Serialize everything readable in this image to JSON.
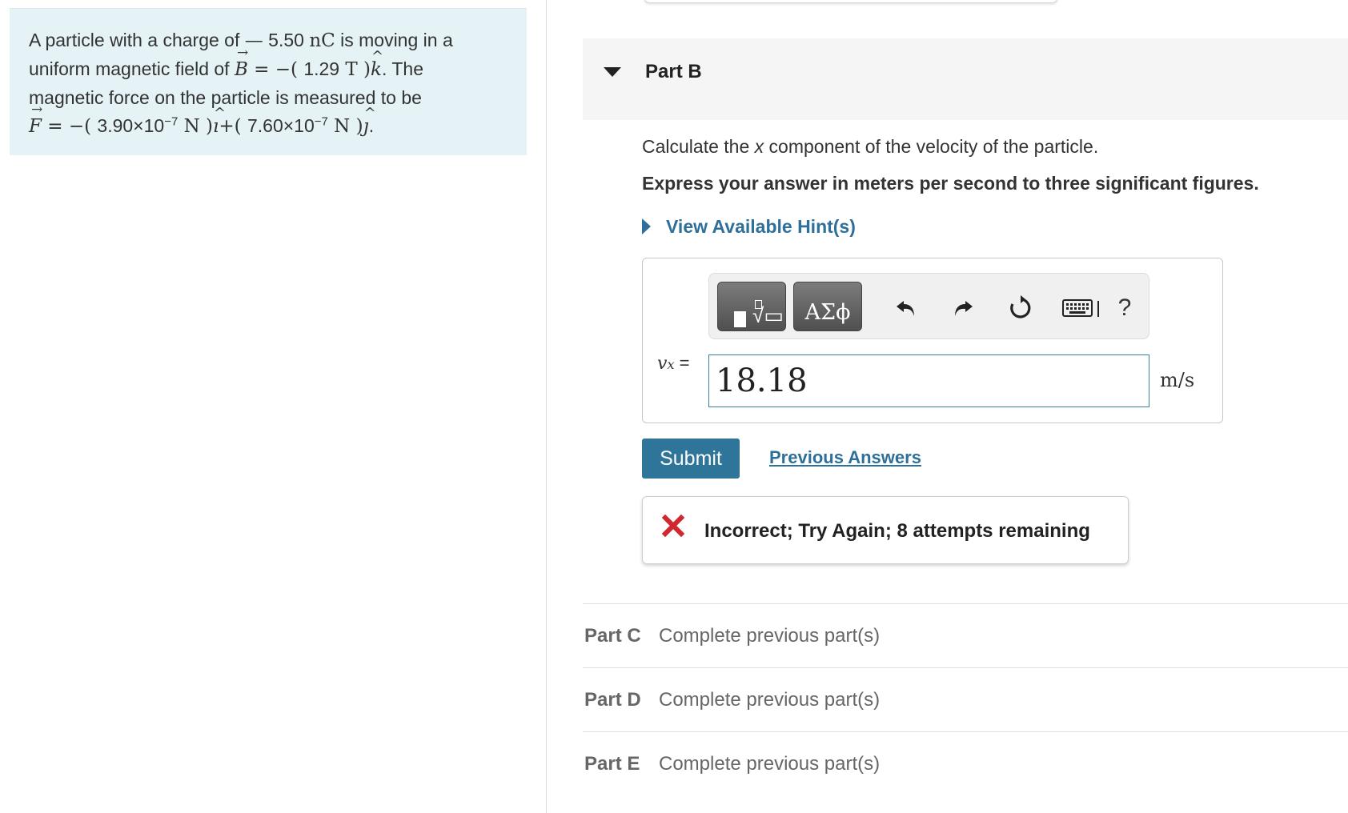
{
  "problem": {
    "line1_prefix": "A particle with a charge of",
    "charge_sign": "—",
    "charge_value": "5.50",
    "charge_unit": "nC",
    "line1_suffix": "is moving in a",
    "line2_prefix": "uniform magnetic field of",
    "field_symbol": "B",
    "field_value": "1.29",
    "field_unit": "T",
    "field_direction": "k",
    "line2_suffix": ". The",
    "line3": "magnetic force on the particle is measured to be",
    "force_symbol": "F",
    "force_x_value": "3.90×10",
    "force_x_exp": "−7",
    "force_x_unit": "N",
    "force_x_direction": "ı",
    "force_y_value": "7.60×10",
    "force_y_exp": "−7",
    "force_y_unit": "N",
    "force_y_direction": "ȷ"
  },
  "part_b": {
    "title": "Part B",
    "question_prefix": "Calculate the ",
    "question_variable": "x",
    "question_suffix": " component of the velocity of the particle.",
    "instruction": "Express your answer in meters per second to three significant figures.",
    "hint_label": "View Available Hint(s)",
    "toolbar": {
      "symbols_label": "ΑΣϕ",
      "help_label": "?",
      "icons": [
        "templates-icon",
        "greek-symbols-icon",
        "undo-icon",
        "redo-icon",
        "reset-icon",
        "keyboard-icon",
        "help-icon"
      ]
    },
    "variable_symbol": "v",
    "variable_subscript": "x",
    "equals": "=",
    "answer_value": "18.18",
    "unit": "m/s",
    "submit_label": "Submit",
    "previous_answers_label": "Previous Answers",
    "feedback": "Incorrect; Try Again; 8 attempts remaining"
  },
  "parts": [
    {
      "label": "Part C",
      "status": "Complete previous part(s)"
    },
    {
      "label": "Part D",
      "status": "Complete previous part(s)"
    },
    {
      "label": "Part E",
      "status": "Complete previous part(s)"
    }
  ],
  "colors": {
    "problem_background": "#e5f3f6",
    "link": "#2e7099",
    "submit_background": "#2f7599",
    "incorrect_red": "#d0282e"
  }
}
